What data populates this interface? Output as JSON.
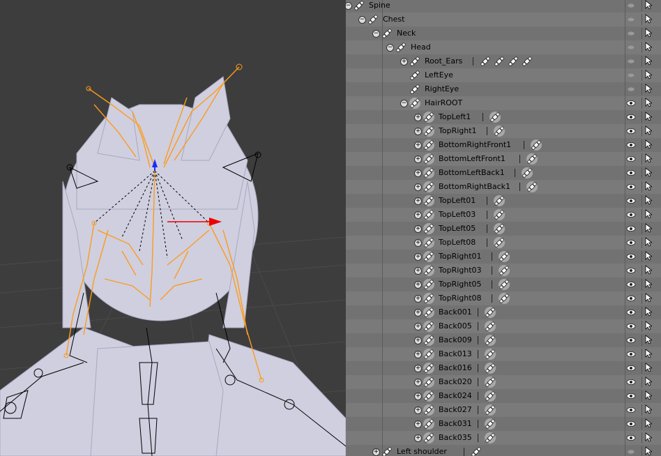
{
  "viewport": {
    "background": "#3d3d3d",
    "mesh_color": "#c8c8d8",
    "bone_selected_color": "#ff9a1a",
    "bone_color": "#000000"
  },
  "outliner": {
    "colors": {
      "row_even": "#7a7a7a",
      "row_odd": "#727272",
      "text": "#000000"
    },
    "rows": [
      {
        "label": "Spine",
        "indent": 4,
        "expander": "minus",
        "children_icons": 0,
        "eye": "dim"
      },
      {
        "label": "Chest",
        "indent": 5,
        "expander": "minus",
        "children_icons": 0,
        "eye": "dim"
      },
      {
        "label": "Neck",
        "indent": 6,
        "expander": "minus",
        "children_icons": 0,
        "eye": "dim"
      },
      {
        "label": "Head",
        "indent": 7,
        "expander": "minus",
        "children_icons": 0,
        "eye": "dim"
      },
      {
        "label": "Root_Ears",
        "indent": 8,
        "expander": "plus",
        "children_icons": 4,
        "eye": "dim"
      },
      {
        "label": "LeftEye",
        "indent": 8,
        "expander": "none",
        "children_icons": 0,
        "eye": "dim"
      },
      {
        "label": "RightEye",
        "indent": 8,
        "expander": "none",
        "children_icons": 0,
        "eye": "dim"
      },
      {
        "label": "HairROOT",
        "indent": 8,
        "expander": "minus",
        "children_icons": 0,
        "eye": "bright",
        "selected": true
      },
      {
        "label": "TopLeft1",
        "indent": 9,
        "expander": "plus",
        "children_icons": 1,
        "eye": "bright",
        "selected": true
      },
      {
        "label": "TopRight1",
        "indent": 9,
        "expander": "plus",
        "children_icons": 1,
        "eye": "bright",
        "selected": true
      },
      {
        "label": "BottomRightFront1",
        "indent": 9,
        "expander": "plus",
        "children_icons": 1,
        "eye": "bright",
        "selected": true
      },
      {
        "label": "BottomLeftFront1",
        "indent": 9,
        "expander": "plus",
        "children_icons": 1,
        "eye": "bright",
        "selected": true
      },
      {
        "label": "BottomLeftBack1",
        "indent": 9,
        "expander": "plus",
        "children_icons": 1,
        "eye": "bright",
        "selected": true
      },
      {
        "label": "BottomRightBack1",
        "indent": 9,
        "expander": "plus",
        "children_icons": 1,
        "eye": "bright",
        "selected": true
      },
      {
        "label": "TopLeft01",
        "indent": 9,
        "expander": "plus",
        "children_icons": 1,
        "eye": "bright",
        "selected": true
      },
      {
        "label": "TopLeft03",
        "indent": 9,
        "expander": "plus",
        "children_icons": 1,
        "eye": "bright",
        "selected": true
      },
      {
        "label": "TopLeft05",
        "indent": 9,
        "expander": "plus",
        "children_icons": 1,
        "eye": "bright",
        "selected": true
      },
      {
        "label": "TopLeft08",
        "indent": 9,
        "expander": "plus",
        "children_icons": 1,
        "eye": "bright",
        "selected": true
      },
      {
        "label": "TopRight01",
        "indent": 9,
        "expander": "plus",
        "children_icons": 1,
        "eye": "bright",
        "selected": true
      },
      {
        "label": "TopRight03",
        "indent": 9,
        "expander": "plus",
        "children_icons": 1,
        "eye": "bright",
        "selected": true
      },
      {
        "label": "TopRight05",
        "indent": 9,
        "expander": "plus",
        "children_icons": 1,
        "eye": "bright",
        "selected": true
      },
      {
        "label": "TopRight08",
        "indent": 9,
        "expander": "plus",
        "children_icons": 1,
        "eye": "bright",
        "selected": true
      },
      {
        "label": "Back001",
        "indent": 9,
        "expander": "plus",
        "children_icons": 1,
        "eye": "bright",
        "selected": true
      },
      {
        "label": "Back005",
        "indent": 9,
        "expander": "plus",
        "children_icons": 1,
        "eye": "bright",
        "selected": true
      },
      {
        "label": "Back009",
        "indent": 9,
        "expander": "plus",
        "children_icons": 1,
        "eye": "bright",
        "selected": true
      },
      {
        "label": "Back013",
        "indent": 9,
        "expander": "plus",
        "children_icons": 1,
        "eye": "bright",
        "selected": true
      },
      {
        "label": "Back016",
        "indent": 9,
        "expander": "plus",
        "children_icons": 1,
        "eye": "bright",
        "selected": true
      },
      {
        "label": "Back020",
        "indent": 9,
        "expander": "plus",
        "children_icons": 1,
        "eye": "bright",
        "selected": true
      },
      {
        "label": "Back024",
        "indent": 9,
        "expander": "plus",
        "children_icons": 1,
        "eye": "bright",
        "selected": true
      },
      {
        "label": "Back027",
        "indent": 9,
        "expander": "plus",
        "children_icons": 1,
        "eye": "bright",
        "selected": true
      },
      {
        "label": "Back031",
        "indent": 9,
        "expander": "plus",
        "children_icons": 1,
        "eye": "bright",
        "selected": true
      },
      {
        "label": "Back035",
        "indent": 9,
        "expander": "plus",
        "children_icons": 1,
        "eye": "bright",
        "selected": true
      },
      {
        "label": "Left shoulder",
        "indent": 6,
        "expander": "plus",
        "children_icons": 1,
        "eye": "dim"
      },
      {
        "label": "",
        "indent": 7,
        "expander": "none",
        "children_icons": 0,
        "eye": "dim"
      }
    ]
  }
}
